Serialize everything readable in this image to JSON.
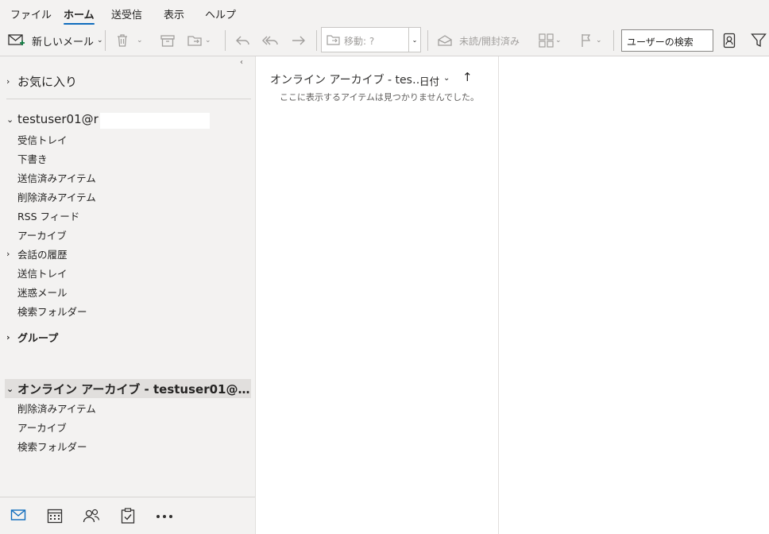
{
  "menu": {
    "tabs": [
      {
        "label": "ファイル"
      },
      {
        "label": "ホーム"
      },
      {
        "label": "送受信"
      },
      {
        "label": "表示"
      },
      {
        "label": "ヘルプ"
      }
    ],
    "active_tab": "ホーム"
  },
  "ribbon": {
    "new_mail_label": "新しいメール",
    "move_label": "移動: ?",
    "unread_read_label": "未読/開封済み",
    "search_user_placeholder": "ユーザーの検索"
  },
  "nav": {
    "collapse_glyph": "‹",
    "favorites_label": "お気に入り",
    "account_label": "testuser01@r",
    "account_folders": [
      {
        "label": "受信トレイ"
      },
      {
        "label": "下書き"
      },
      {
        "label": "送信済みアイテム"
      },
      {
        "label": "削除済みアイテム"
      },
      {
        "label": "RSS フィード"
      },
      {
        "label": "アーカイブ"
      },
      {
        "label": "会話の履歴"
      },
      {
        "label": "送信トレイ"
      },
      {
        "label": "迷惑メール"
      },
      {
        "label": "検索フォルダー"
      }
    ],
    "groups_label": "グループ",
    "archive_label": "オンライン アーカイブ - testuser01@…",
    "archive_folders": [
      {
        "label": "削除済みアイテム"
      },
      {
        "label": "アーカイブ"
      },
      {
        "label": "検索フォルダー"
      }
    ]
  },
  "message_list": {
    "title": "オンライン アーカイブ - tes…",
    "sort_label": "日付",
    "empty_text": "ここに表示するアイテムは見つかりませんでした。"
  },
  "colors": {
    "accent": "#0f6cbd",
    "pane_bg": "#f3f2f1",
    "selected_row": "#e1dfdd"
  }
}
